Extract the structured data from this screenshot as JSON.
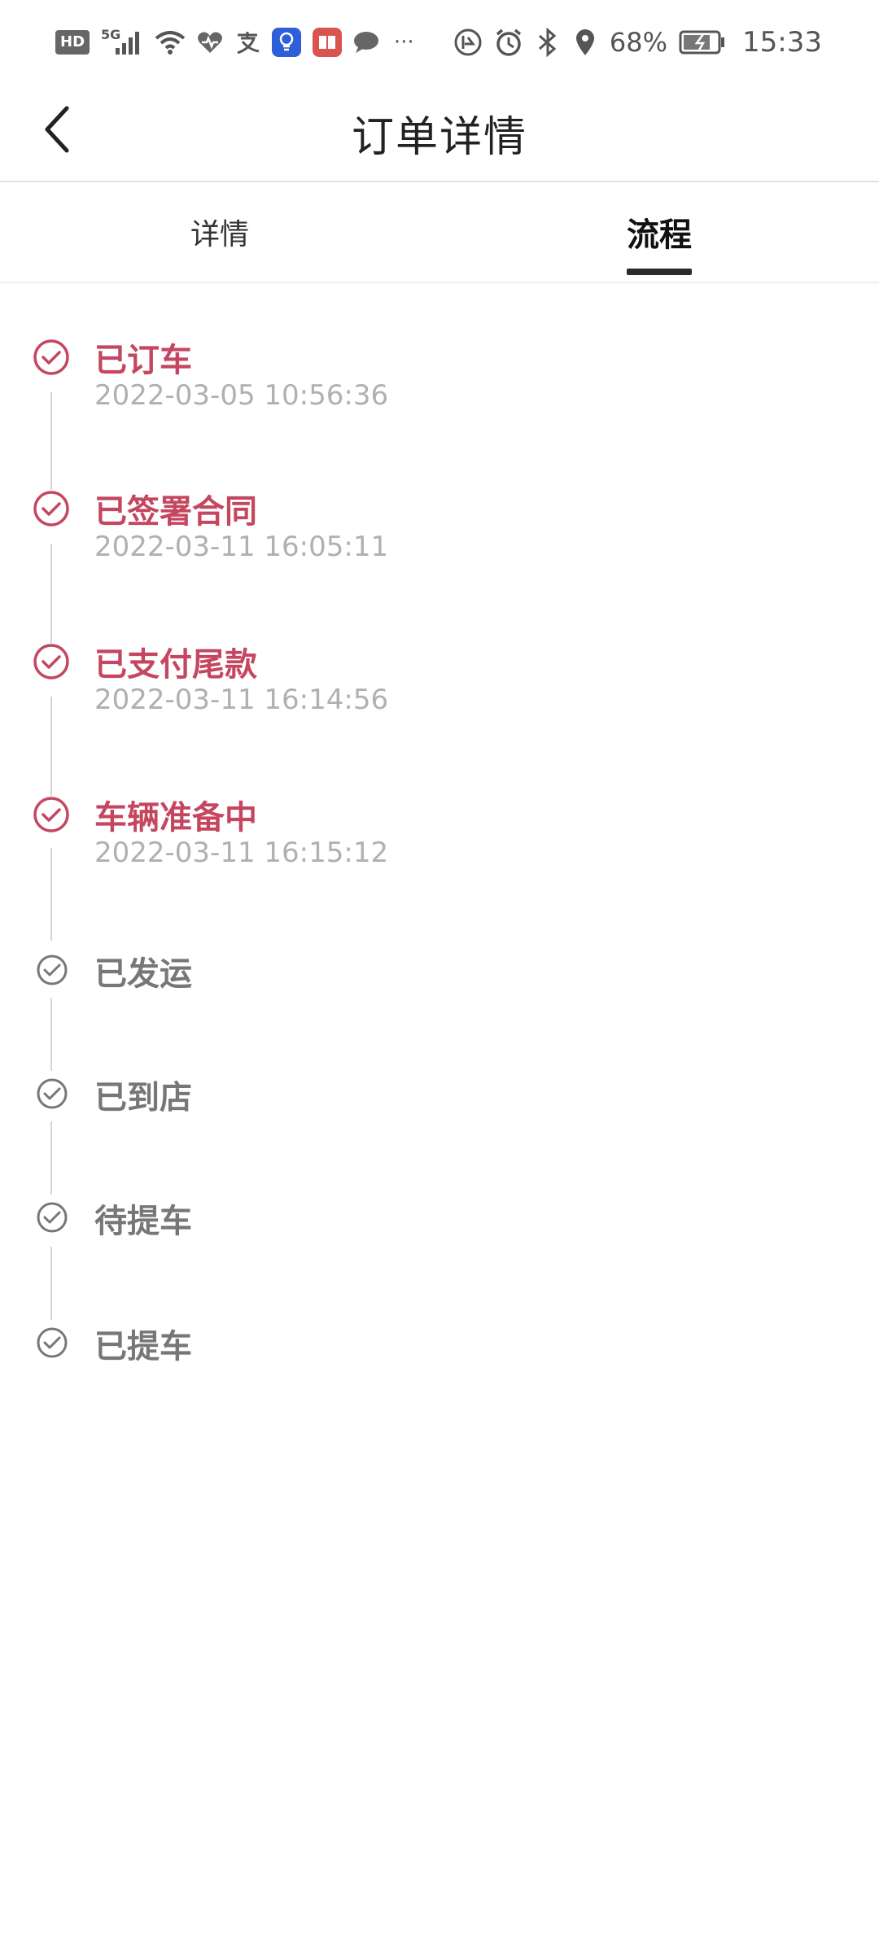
{
  "status_bar": {
    "hd": "HD",
    "network": "5G",
    "battery": "68%",
    "time": "15:33",
    "more": "···"
  },
  "header": {
    "title": "订单详情"
  },
  "tabs": [
    {
      "label": "详情",
      "active": false
    },
    {
      "label": "流程",
      "active": true
    }
  ],
  "timeline": [
    {
      "label": "已订车",
      "time": "2022-03-05 10:56:36",
      "done": true
    },
    {
      "label": "已签署合同",
      "time": "2022-03-11 16:05:11",
      "done": true
    },
    {
      "label": "已支付尾款",
      "time": "2022-03-11 16:14:56",
      "done": true
    },
    {
      "label": "车辆准备中",
      "time": "2022-03-11 16:15:12",
      "done": true
    },
    {
      "label": "已发运",
      "time": "",
      "done": false
    },
    {
      "label": "已到店",
      "time": "",
      "done": false
    },
    {
      "label": "待提车",
      "time": "",
      "done": false
    },
    {
      "label": "已提车",
      "time": "",
      "done": false
    }
  ],
  "colors": {
    "accent": "#c4475f",
    "pending": "#777777",
    "time_text": "#b0b0b0"
  }
}
